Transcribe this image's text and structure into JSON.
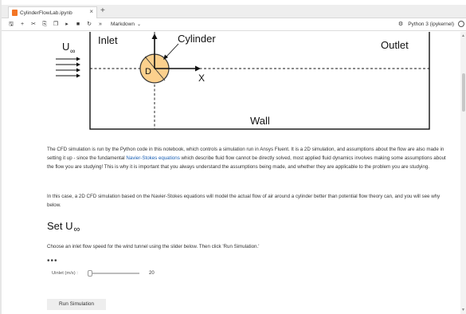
{
  "tabs": [
    {
      "label": "CylinderFlowLab.ipynb",
      "icon": "jupyter-notebook-icon",
      "close": "×"
    }
  ],
  "new_tab_label": "+",
  "toolbar": {
    "buttons": [
      "save-icon",
      "add-cell-icon",
      "cut-icon",
      "copy-icon",
      "paste-icon",
      "run-icon",
      "stop-icon",
      "restart-icon",
      "fast-forward-icon"
    ],
    "glyphs": [
      "🖫",
      "+",
      "✂",
      "⎘",
      "❐",
      "▸",
      "■",
      "↻",
      "»"
    ],
    "cell_type": "Markdown",
    "kernel_name": "Python 3 (ipykernel)"
  },
  "diagram": {
    "inlet": "Inlet",
    "outlet": "Outlet",
    "cylinder": "Cylinder",
    "wall": "Wall",
    "velocity": "U",
    "velocity_sub": "∞",
    "diameter": "D",
    "x_axis": "X",
    "colors": {
      "cylinder_fill": "#fcd08d",
      "cylinder_stroke": "#333333"
    }
  },
  "paragraphs": {
    "p1_before": "The CFD simulation is run by the Python code in this notebook, which controls a simulation run in Ansys Fluent. It is a 2D simulation, and assumptions about the flow are also made in setting it up - since the fundamental ",
    "p1_link": "Navier-Stokes equations",
    "p1_after": " which describe fluid flow cannot be directly solved, most applied fluid dynamics involves making some assumptions about the flow you are studying! This is why it is important that you always understand the assumptions being made, and whether they are applicable to the problem you are studying.",
    "p2": "In this case, a 2D CFD simulation based on the Navier-Stokes equations will model the actual flow of air around a cylinder better than potential flow theory can, and you will see why below."
  },
  "section": {
    "heading": "Set U",
    "heading_sub": "∞",
    "instruction": "Choose an inlet flow speed for the wind tunnel using the slider below. Then click 'Run Simulation.'",
    "ellipsis": "•••"
  },
  "slider": {
    "label": "Uinlet (m/s) :",
    "value": "20",
    "level": 0.0
  },
  "run_button": {
    "label": "Run Simulation"
  }
}
